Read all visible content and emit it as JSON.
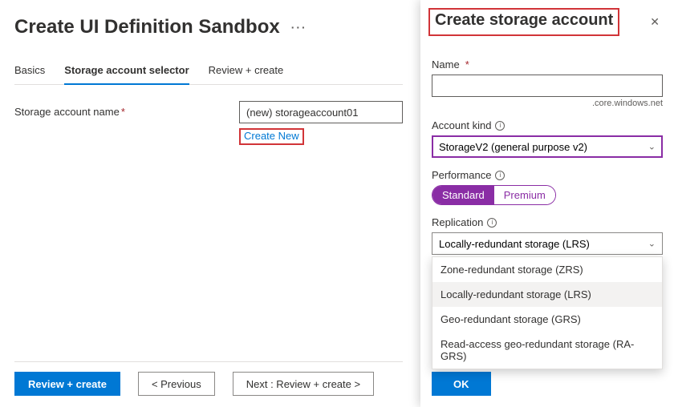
{
  "page": {
    "title": "Create UI Definition Sandbox",
    "moreIcon": "···"
  },
  "tabs": [
    {
      "label": "Basics"
    },
    {
      "label": "Storage account selector",
      "selected": true
    },
    {
      "label": "Review + create"
    }
  ],
  "form": {
    "storageAccount": {
      "label": "Storage account name",
      "required": "*",
      "value": "(new) storageaccount01",
      "createNew": "Create New"
    }
  },
  "footer": {
    "review": "Review + create",
    "previous": "< Previous",
    "next": "Next : Review + create >"
  },
  "panel": {
    "title": "Create storage account",
    "name": {
      "label": "Name",
      "required": "*",
      "value": "",
      "suffix": ".core.windows.net"
    },
    "accountKind": {
      "label": "Account kind",
      "selected": "StorageV2 (general purpose v2)"
    },
    "performance": {
      "label": "Performance",
      "options": [
        "Standard",
        "Premium"
      ],
      "selected": "Standard"
    },
    "replication": {
      "label": "Replication",
      "selected": "Locally-redundant storage (LRS)",
      "options": [
        "Zone-redundant storage (ZRS)",
        "Locally-redundant storage (LRS)",
        "Geo-redundant storage (GRS)",
        "Read-access geo-redundant storage (RA-GRS)"
      ]
    },
    "ok": "OK"
  }
}
